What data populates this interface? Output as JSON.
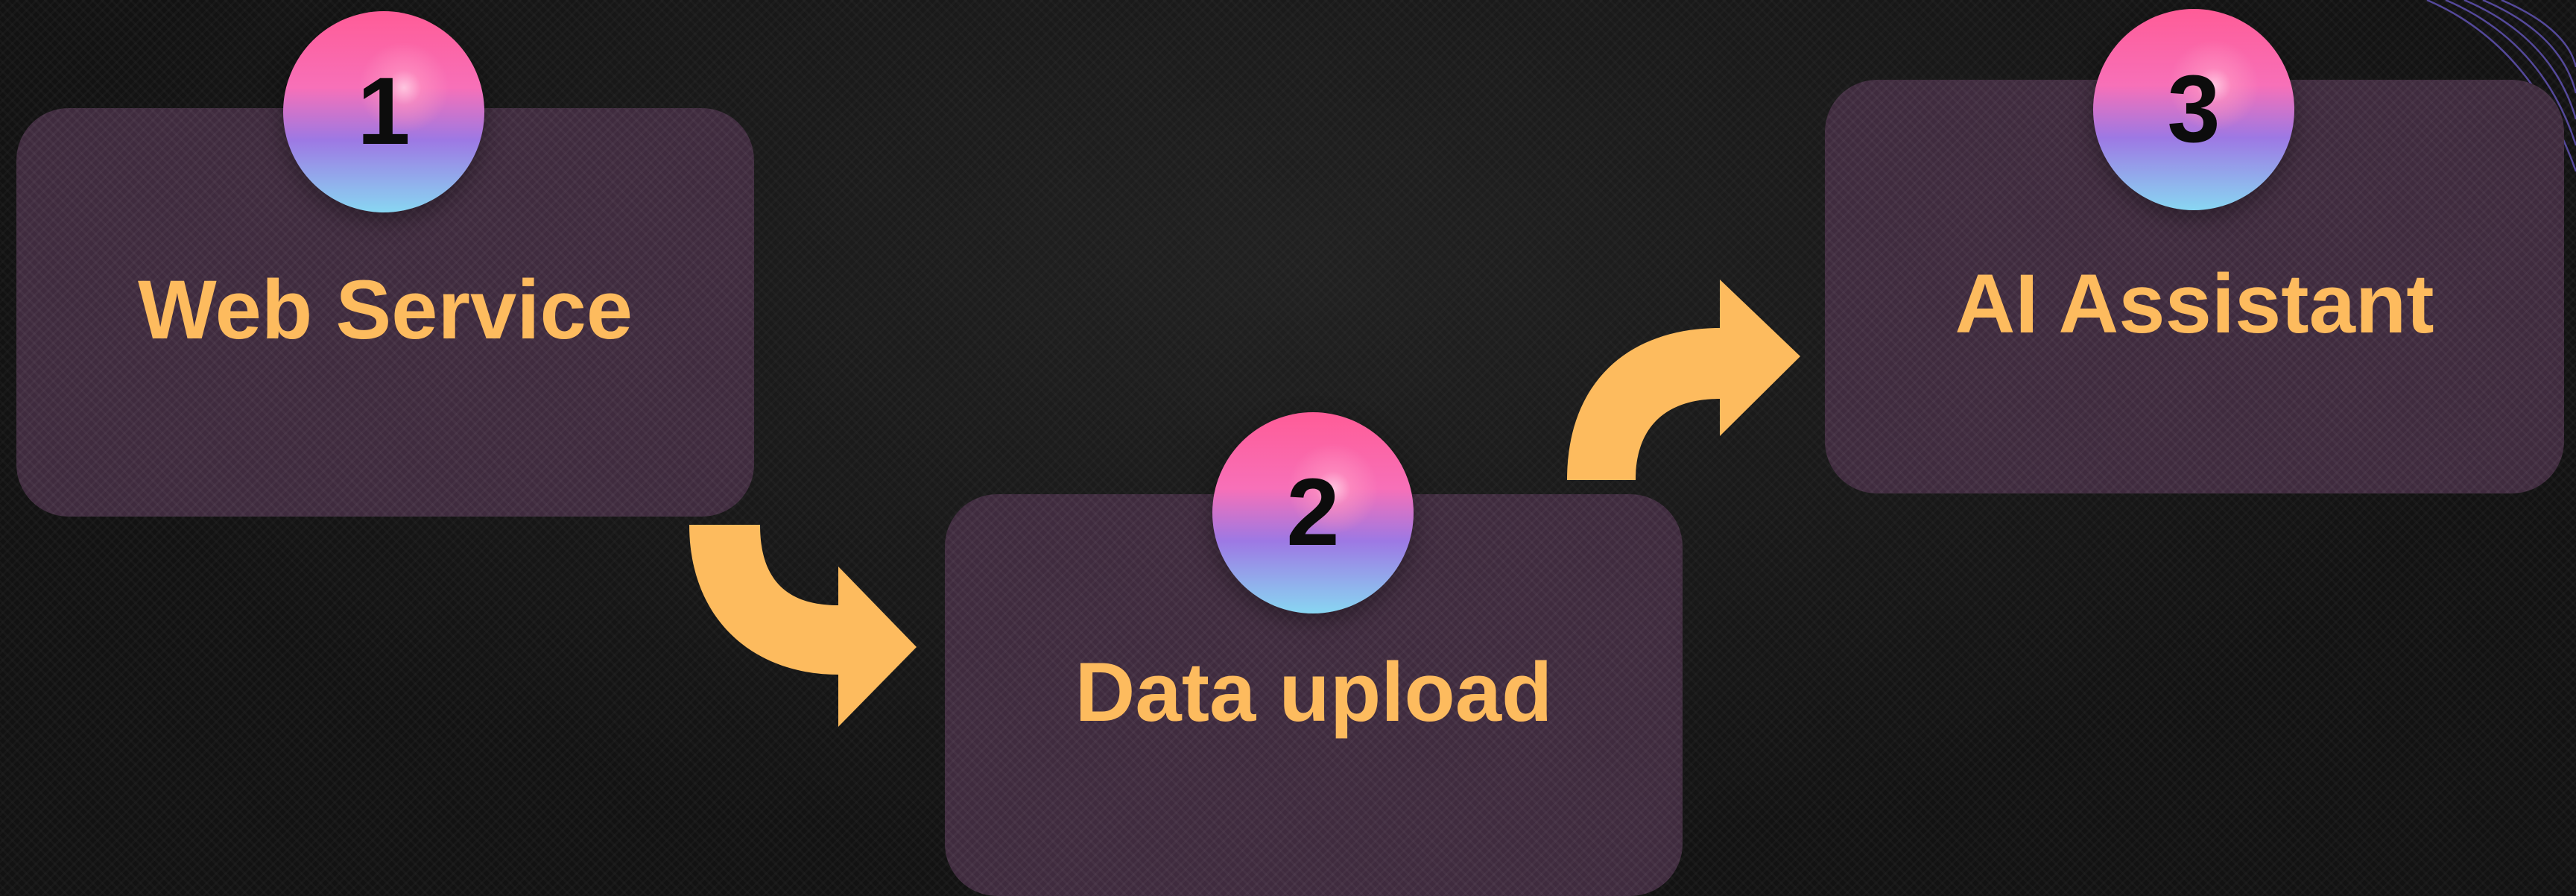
{
  "steps": [
    {
      "number": "1",
      "label": "Web Service"
    },
    {
      "number": "2",
      "label": "Data upload"
    },
    {
      "number": "3",
      "label": "AI Assistant"
    }
  ],
  "colors": {
    "background": "#121212",
    "box": "#3f2b3e",
    "label": "#fdbb5e",
    "arrow": "#fdbb5e",
    "badge_top": "#ff5c97",
    "badge_bottom": "#88d6f2",
    "number": "#0c0c0c"
  },
  "icons": {
    "arrow_1_to_2": "curved-arrow-down-right-icon",
    "arrow_2_to_3": "curved-arrow-up-right-icon"
  }
}
